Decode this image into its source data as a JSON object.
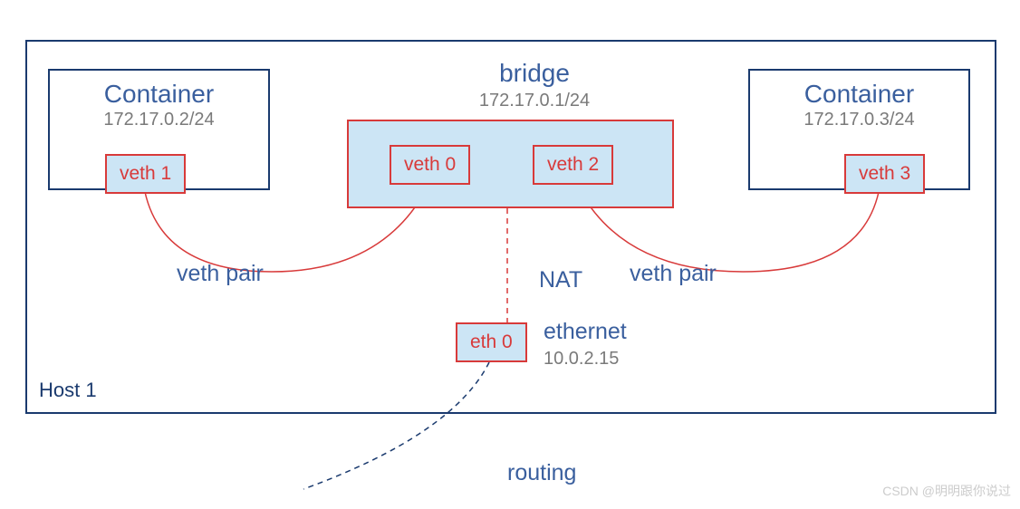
{
  "host": {
    "label": "Host 1"
  },
  "container1": {
    "title": "Container",
    "ip": "172.17.0.2/24"
  },
  "container2": {
    "title": "Container",
    "ip": "172.17.0.3/24"
  },
  "bridge": {
    "title": "bridge",
    "ip": "172.17.0.1/24"
  },
  "veth": {
    "v0": "veth 0",
    "v1": "veth 1",
    "v2": "veth 2",
    "v3": "veth 3"
  },
  "eth0": {
    "label": "eth 0",
    "name": "ethernet",
    "ip": "10.0.2.15"
  },
  "labels": {
    "nat": "NAT",
    "vethpair": "veth pair",
    "routing": "routing"
  },
  "watermark": "CSDN @明明跟你说过"
}
